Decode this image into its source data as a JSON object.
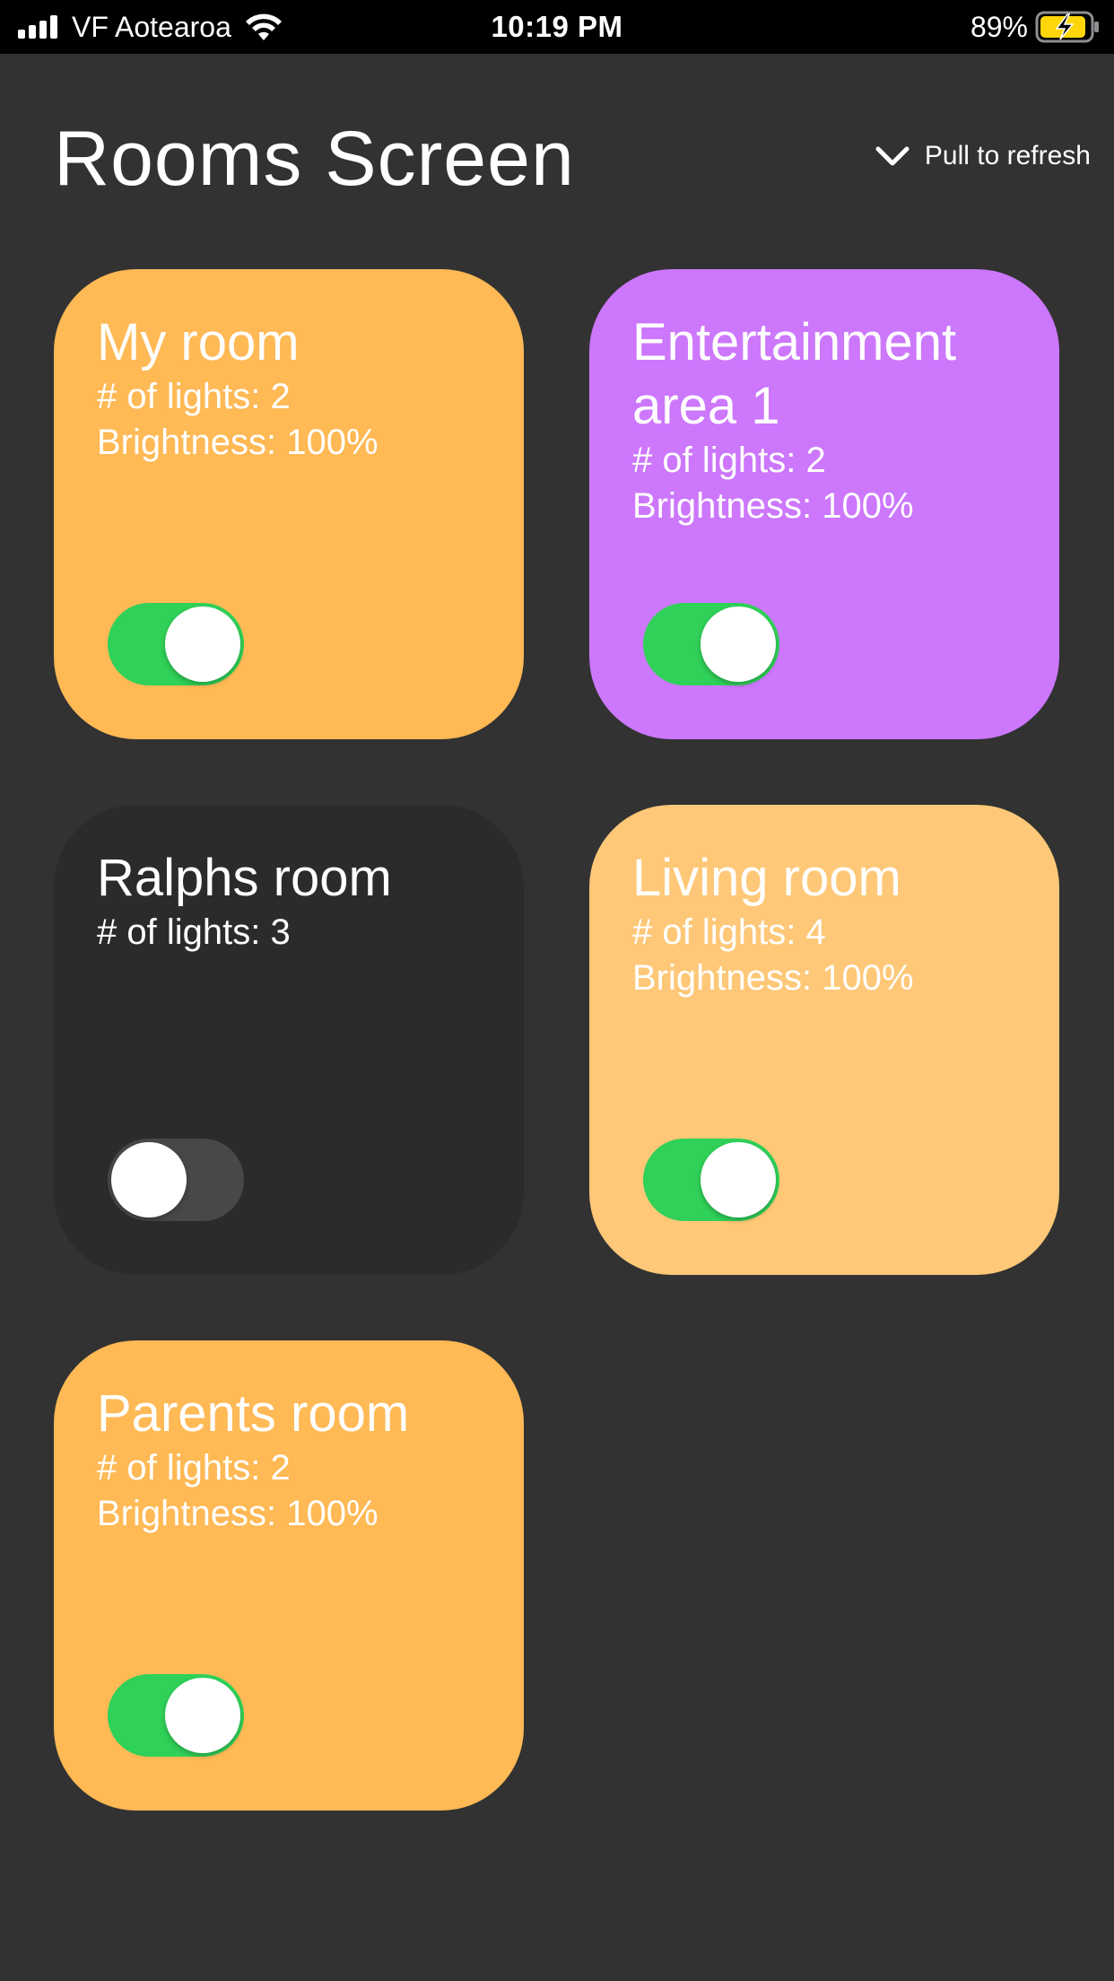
{
  "status_bar": {
    "carrier": "VF Aotearoa",
    "time": "10:19 PM",
    "battery_percent": "89%",
    "icons": [
      "signal-icon",
      "wifi-icon",
      "battery-charging-icon"
    ]
  },
  "header": {
    "title": "Rooms Screen",
    "refresh_hint": "Pull to refresh",
    "refresh_icon": "chevron-down-icon"
  },
  "rooms": [
    {
      "name": "My room",
      "lights": "# of lights: 2",
      "brightness": "Brightness: 100%",
      "on": true,
      "color": "#ffb955"
    },
    {
      "name": "Entertainment area 1",
      "lights": "# of lights: 2",
      "brightness": "Brightness: 100%",
      "on": true,
      "color": "#cc77fc"
    },
    {
      "name": "Ralphs room",
      "lights": "# of lights: 3",
      "brightness": "",
      "on": false,
      "color": "#2b2b2b"
    },
    {
      "name": "Living room",
      "lights": "# of lights: 4",
      "brightness": "Brightness: 100%",
      "on": true,
      "color": "#fec878"
    },
    {
      "name": "Parents room",
      "lights": "# of lights: 2",
      "brightness": "Brightness: 100%",
      "on": true,
      "color": "#ffb955"
    }
  ],
  "colors": {
    "background": "#323232",
    "status_bar": "#000000",
    "toggle_on": "#30d158",
    "toggle_off": "#48484a",
    "battery_charging": "#ffd60a"
  }
}
